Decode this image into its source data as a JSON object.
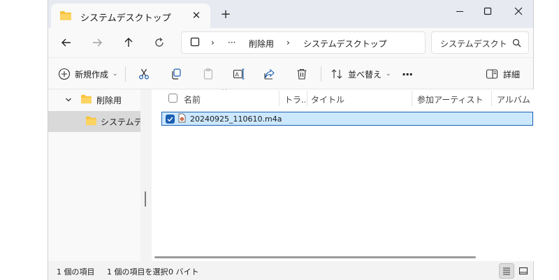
{
  "window": {
    "tab_title": "システムデスクトップ",
    "tab_close": "✕",
    "new_tab": "+",
    "minimize_icon": "minimize",
    "maximize_icon": "maximize",
    "close_icon": "close"
  },
  "addressbar": {
    "ellipsis": "···",
    "crumbs": [
      "削除用",
      "システムデスクトップ"
    ]
  },
  "search": {
    "placeholder": "システムデスクト"
  },
  "toolbar": {
    "new_label": "新規作成",
    "sort_label": "並べ替え",
    "more_label": "···",
    "details_label": "詳細"
  },
  "nav": {
    "items": [
      {
        "label": "削除用",
        "expanded": true
      },
      {
        "label": "システムデスクトップ",
        "selected": true
      }
    ]
  },
  "columns": [
    "名前",
    "トラック",
    "タイトル",
    "参加アーティスト",
    "アルバム"
  ],
  "columns_display": [
    "名前",
    "トラ...",
    "タイトル",
    "参加アーティスト",
    "アルバム"
  ],
  "files": [
    {
      "name": "20240925_110610.m4a",
      "selected": true
    }
  ],
  "status": {
    "count": "1 個の項目",
    "selection": "1 個の項目を選択",
    "size": "0 バイト"
  },
  "colors": {
    "selection_bg": "#cce8ff",
    "selection_border": "#1a5fb4",
    "folder_yellow": "#f8c23b"
  }
}
